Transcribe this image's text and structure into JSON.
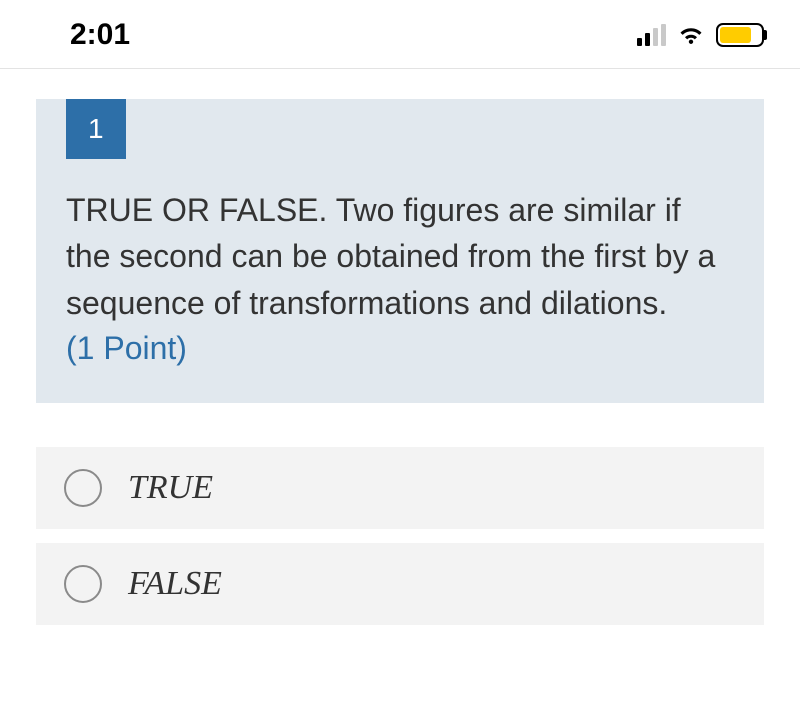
{
  "statusBar": {
    "time": "2:01"
  },
  "question": {
    "number": "1",
    "text": "TRUE OR FALSE. Two figures are similar if the second can be obtained from the first by a sequence of transformations and dilations.",
    "points": "(1 Point)"
  },
  "options": [
    {
      "label": "TRUE"
    },
    {
      "label": "FALSE"
    }
  ]
}
